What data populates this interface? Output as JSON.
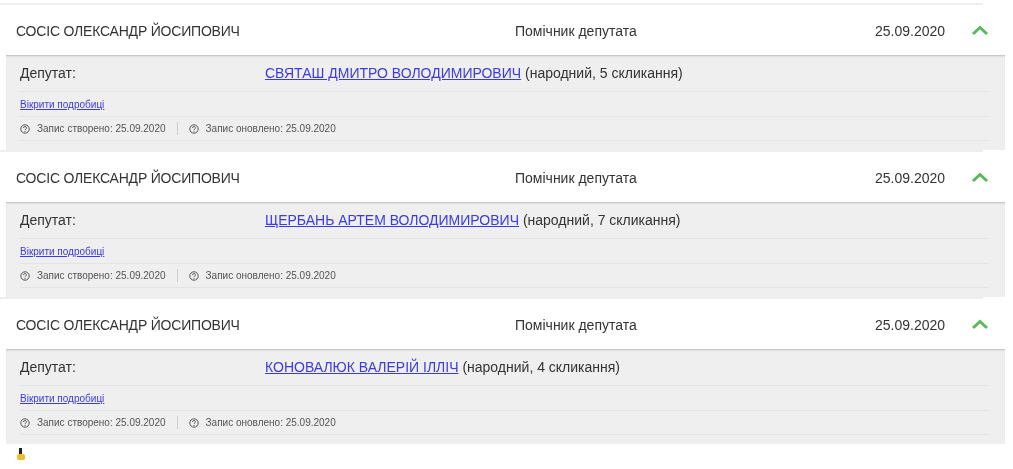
{
  "records": [
    {
      "name": "СОСІС ОЛЕКСАНДР ЙОСИПОВИЧ",
      "role": "Помічник депутата",
      "date": "25.09.2020",
      "expanded": true,
      "details": {
        "label": "Депутат:",
        "deputy": "СВЯТАШ ДМИТРО ВОЛОДИМИРОВИЧ",
        "deputy_note": "(народний, 5 скликання)",
        "more_link": "Вікрити подробиці",
        "created": "Запис створено: 25.09.2020",
        "updated": "Запис оновлено: 25.09.2020"
      }
    },
    {
      "name": "СОСІС ОЛЕКСАНДР ЙОСИПОВИЧ",
      "role": "Помічник депутата",
      "date": "25.09.2020",
      "expanded": true,
      "details": {
        "label": "Депутат:",
        "deputy": "ЩЕРБАНЬ АРТЕМ ВОЛОДИМИРОВИЧ",
        "deputy_note": "(народний, 7 скликання)",
        "more_link": "Вікрити подробиці",
        "created": "Запис створено: 25.09.2020",
        "updated": "Запис оновлено: 25.09.2020"
      }
    },
    {
      "name": "СОСІС ОЛЕКСАНДР ЙОСИПОВИЧ",
      "role": "Помічник депутата",
      "date": "25.09.2020",
      "expanded": true,
      "details": {
        "label": "Депутат:",
        "deputy": "КОНОВАЛЮК ВАЛЕРІЙ ІЛЛІЧ",
        "deputy_note": "(народний, 4 скликання)",
        "more_link": "Вікрити подробиці",
        "created": "Запис створено: 25.09.2020",
        "updated": "Запис оновлено: 25.09.2020"
      }
    }
  ]
}
